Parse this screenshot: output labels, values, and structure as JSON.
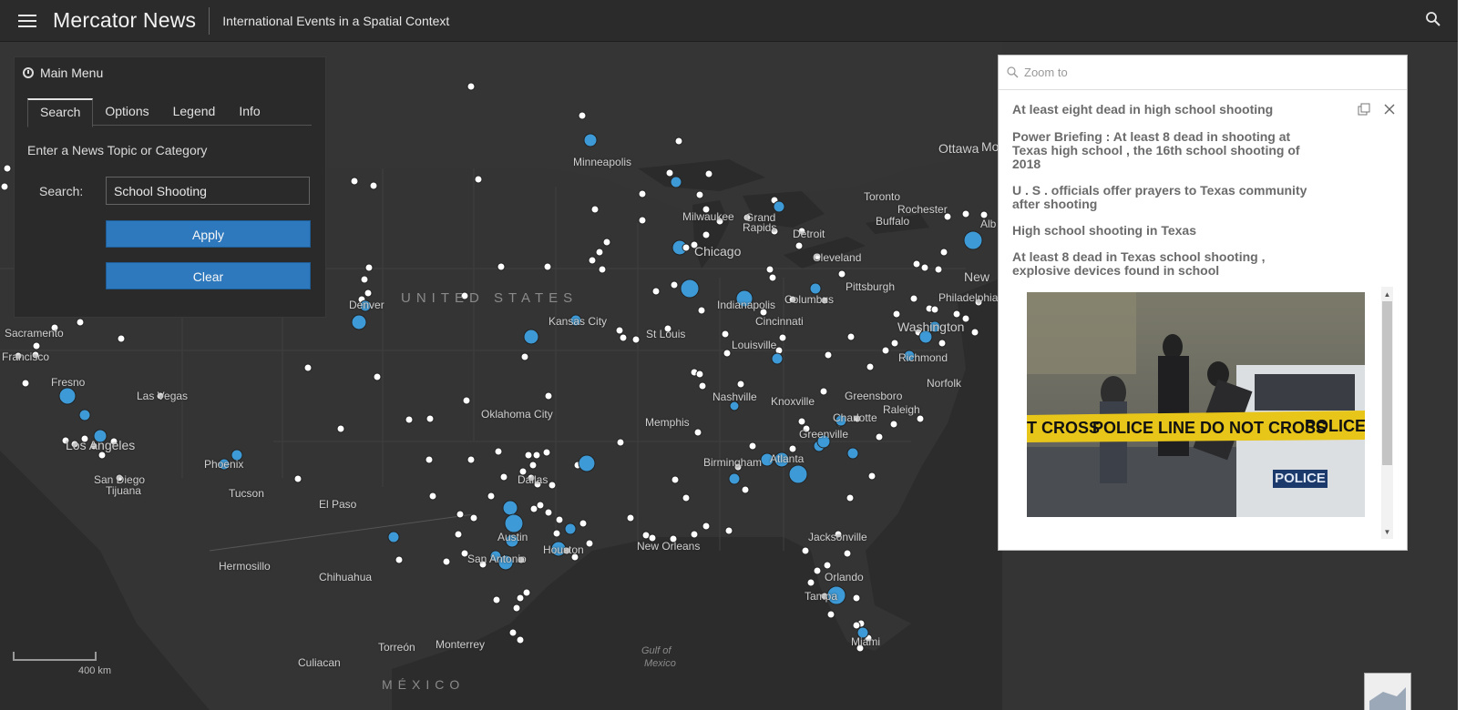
{
  "header": {
    "title": "Mercator News",
    "subtitle": "International Events in a Spatial Context",
    "menu_icon": "hamburger-icon",
    "search_icon": "search-icon"
  },
  "menu": {
    "title": "Main Menu",
    "tabs": [
      {
        "label": "Search",
        "active": true
      },
      {
        "label": "Options",
        "active": false
      },
      {
        "label": "Legend",
        "active": false
      },
      {
        "label": "Info",
        "active": false
      }
    ],
    "prompt": "Enter a News Topic or Category",
    "search_label": "Search:",
    "search_value": "School Shooting",
    "apply_label": "Apply",
    "clear_label": "Clear"
  },
  "popup": {
    "zoom_placeholder": "Zoom to",
    "title": "At least eight dead in high school shooting",
    "headlines": [
      "Power Briefing : At least 8 dead in shooting at Texas high school , the 16th school shooting of 2018",
      "U . S . officials offer prayers to Texas community after shooting",
      "High school shooting in Texas",
      "At least 8 dead in Texas school shooting , explosive devices found in school"
    ],
    "image_text": {
      "tape_left": "T CROSS",
      "tape_mid": "POLICE LINE DO NOT CROSS",
      "tape_right": "POLICE LINE DO NO",
      "car_label": "POLICE"
    }
  },
  "map": {
    "labels": {
      "ottawa": "Ottawa",
      "mo": "Mo",
      "minneapolis": "Minneapolis",
      "toronto": "Toronto",
      "rochester": "Rochester",
      "buffalo": "Buffalo",
      "alb": "Alb",
      "milwaukee": "Milwaukee",
      "grand_rapids_1": "Grand",
      "grand_rapids_2": "Rapids",
      "detroit": "Detroit",
      "chicago": "Chicago",
      "cleveland": "Cleveland",
      "pittsburgh": "Pittsburgh",
      "new_york": "New",
      "philadelphia": "Philadelphia",
      "united_states": "UNITED STATES",
      "denver": "Denver",
      "kansas_city": "Kansas City",
      "indianapolis": "Indianapolis",
      "columbus": "Columbus",
      "cincinnati": "Cincinnati",
      "washington": "Washington",
      "st_louis": "St Louis",
      "louisville": "Louisville",
      "richmond": "Richmond",
      "sacramento": "Sacramento",
      "francisco": "Francisco",
      "fresno": "Fresno",
      "las_vegas": "Las Vegas",
      "norfolk": "Norfolk",
      "nashville": "Nashville",
      "knoxville": "Knoxville",
      "greensboro": "Greensboro",
      "raleigh": "Raleigh",
      "oklahoma_city": "Oklahoma City",
      "memphis": "Memphis",
      "charlotte": "Charlotte",
      "greenville": "Greenville",
      "los_angeles": "Los Angeles",
      "phoenix": "Phoenix",
      "birmingham": "Birmingham",
      "atlanta": "Atlanta",
      "san_diego": "San Diego",
      "tijuana": "Tijuana",
      "tucson": "Tucson",
      "dallas": "Dallas",
      "el_paso": "El Paso",
      "austin": "Austin",
      "houston": "Houston",
      "new_orleans": "New Orleans",
      "jacksonville": "Jacksonville",
      "san_antonio": "San Antonio",
      "hermosillo": "Hermosillo",
      "chihuahua": "Chihuahua",
      "orlando": "Orlando",
      "tampa": "Tampa",
      "miami": "Miami",
      "torreon": "Torreón",
      "monterrey": "Monterrey",
      "culiacan": "Culiacan",
      "mexico": "MÉXICO",
      "gulf_1": "Gulf of",
      "gulf_2": "Mexico"
    },
    "scale_label": "400 km"
  }
}
